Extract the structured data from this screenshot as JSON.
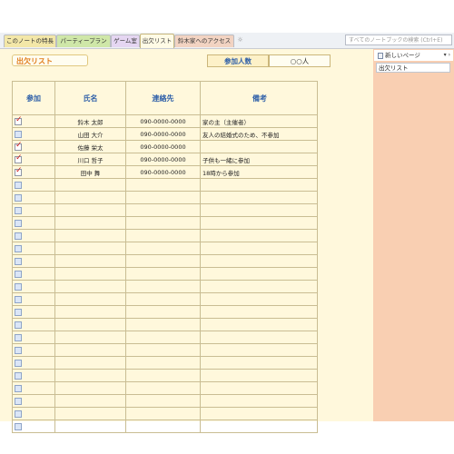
{
  "tabs": [
    {
      "label": "このノートの特長",
      "active": false,
      "color": "#f3e7a8"
    },
    {
      "label": "パーティープラン",
      "active": false,
      "color": "#cfe7a8"
    },
    {
      "label": "ゲーム室",
      "active": false,
      "color": "#e5d6f2"
    },
    {
      "label": "出欠リスト",
      "active": true,
      "color": "#fffbe6"
    },
    {
      "label": "鈴木家へのアクセス",
      "active": false,
      "color": "#f2d3c2"
    }
  ],
  "search": {
    "placeholder": "すべてのノートブックの検索 (Ctrl+E)"
  },
  "page": {
    "title": "出欠リスト",
    "count_label": "参加人数",
    "count_value": "○○人"
  },
  "table": {
    "headers": [
      "参加",
      "氏名",
      "連絡先",
      "備考"
    ],
    "rows": [
      {
        "checked": true,
        "name": "鈴木 太郎",
        "phone": "090-0000-0000",
        "note": "家の主（主催者）"
      },
      {
        "checked": false,
        "name": "山田 大介",
        "phone": "090-0000-0000",
        "note": "友人の結婚式のため、不参加"
      },
      {
        "checked": true,
        "name": "佐藤 栄太",
        "phone": "090-0000-0000",
        "note": ""
      },
      {
        "checked": true,
        "name": "川口 哲子",
        "phone": "090-0000-0000",
        "note": "子供も一緒に参加"
      },
      {
        "checked": true,
        "name": "田中 舞",
        "phone": "090-0000-0000",
        "note": "18時から参加"
      },
      {
        "checked": false,
        "name": "",
        "phone": "",
        "note": ""
      },
      {
        "checked": false,
        "name": "",
        "phone": "",
        "note": ""
      },
      {
        "checked": false,
        "name": "",
        "phone": "",
        "note": ""
      },
      {
        "checked": false,
        "name": "",
        "phone": "",
        "note": ""
      },
      {
        "checked": false,
        "name": "",
        "phone": "",
        "note": ""
      },
      {
        "checked": false,
        "name": "",
        "phone": "",
        "note": ""
      },
      {
        "checked": false,
        "name": "",
        "phone": "",
        "note": ""
      },
      {
        "checked": false,
        "name": "",
        "phone": "",
        "note": ""
      },
      {
        "checked": false,
        "name": "",
        "phone": "",
        "note": ""
      },
      {
        "checked": false,
        "name": "",
        "phone": "",
        "note": ""
      },
      {
        "checked": false,
        "name": "",
        "phone": "",
        "note": ""
      },
      {
        "checked": false,
        "name": "",
        "phone": "",
        "note": ""
      },
      {
        "checked": false,
        "name": "",
        "phone": "",
        "note": ""
      },
      {
        "checked": false,
        "name": "",
        "phone": "",
        "note": ""
      },
      {
        "checked": false,
        "name": "",
        "phone": "",
        "note": ""
      },
      {
        "checked": false,
        "name": "",
        "phone": "",
        "note": ""
      },
      {
        "checked": false,
        "name": "",
        "phone": "",
        "note": ""
      },
      {
        "checked": false,
        "name": "",
        "phone": "",
        "note": ""
      },
      {
        "checked": false,
        "name": "",
        "phone": "",
        "note": ""
      },
      {
        "checked": false,
        "name": "",
        "phone": "",
        "note": ""
      }
    ]
  },
  "right_panel": {
    "new_page_label": "新しいページ",
    "pages": [
      "出欠リスト"
    ]
  }
}
